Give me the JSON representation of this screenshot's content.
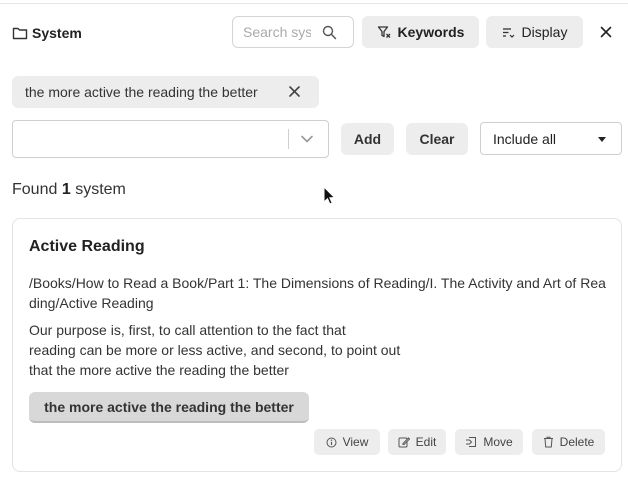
{
  "header": {
    "title": "System",
    "search_placeholder": "Search systems",
    "keywords_label": "Keywords",
    "display_label": "Display"
  },
  "filter_chip": {
    "label": "the more active the reading the better"
  },
  "controls": {
    "add_label": "Add",
    "clear_label": "Clear",
    "include_mode": "Include all"
  },
  "results": {
    "prefix": "Found",
    "count": "1",
    "suffix": "system"
  },
  "card": {
    "title": "Active Reading",
    "path": "/Books/How to Read a Book/Part 1: The Dimensions of Reading/I. The Activity and Art of Reading/Active Reading",
    "description_lines": [
      "Our purpose is, first, to call attention to the fact that",
      "reading can be more or less active, and second, to point out",
      "that the more active the reading the better"
    ],
    "keyword": "the more active the reading the better",
    "actions": {
      "view": "View",
      "edit": "Edit",
      "move": "Move",
      "delete": "Delete"
    }
  },
  "icons": {
    "title": "folder-icon",
    "search": "search-icon",
    "keywords": "filter-icon",
    "display": "sort-lines-icon",
    "close": "close-icon",
    "chip_remove": "close-icon",
    "dropdown": "chevron-down-icon",
    "view": "info-icon",
    "edit": "edit-icon",
    "move": "move-icon",
    "delete": "trash-icon"
  }
}
